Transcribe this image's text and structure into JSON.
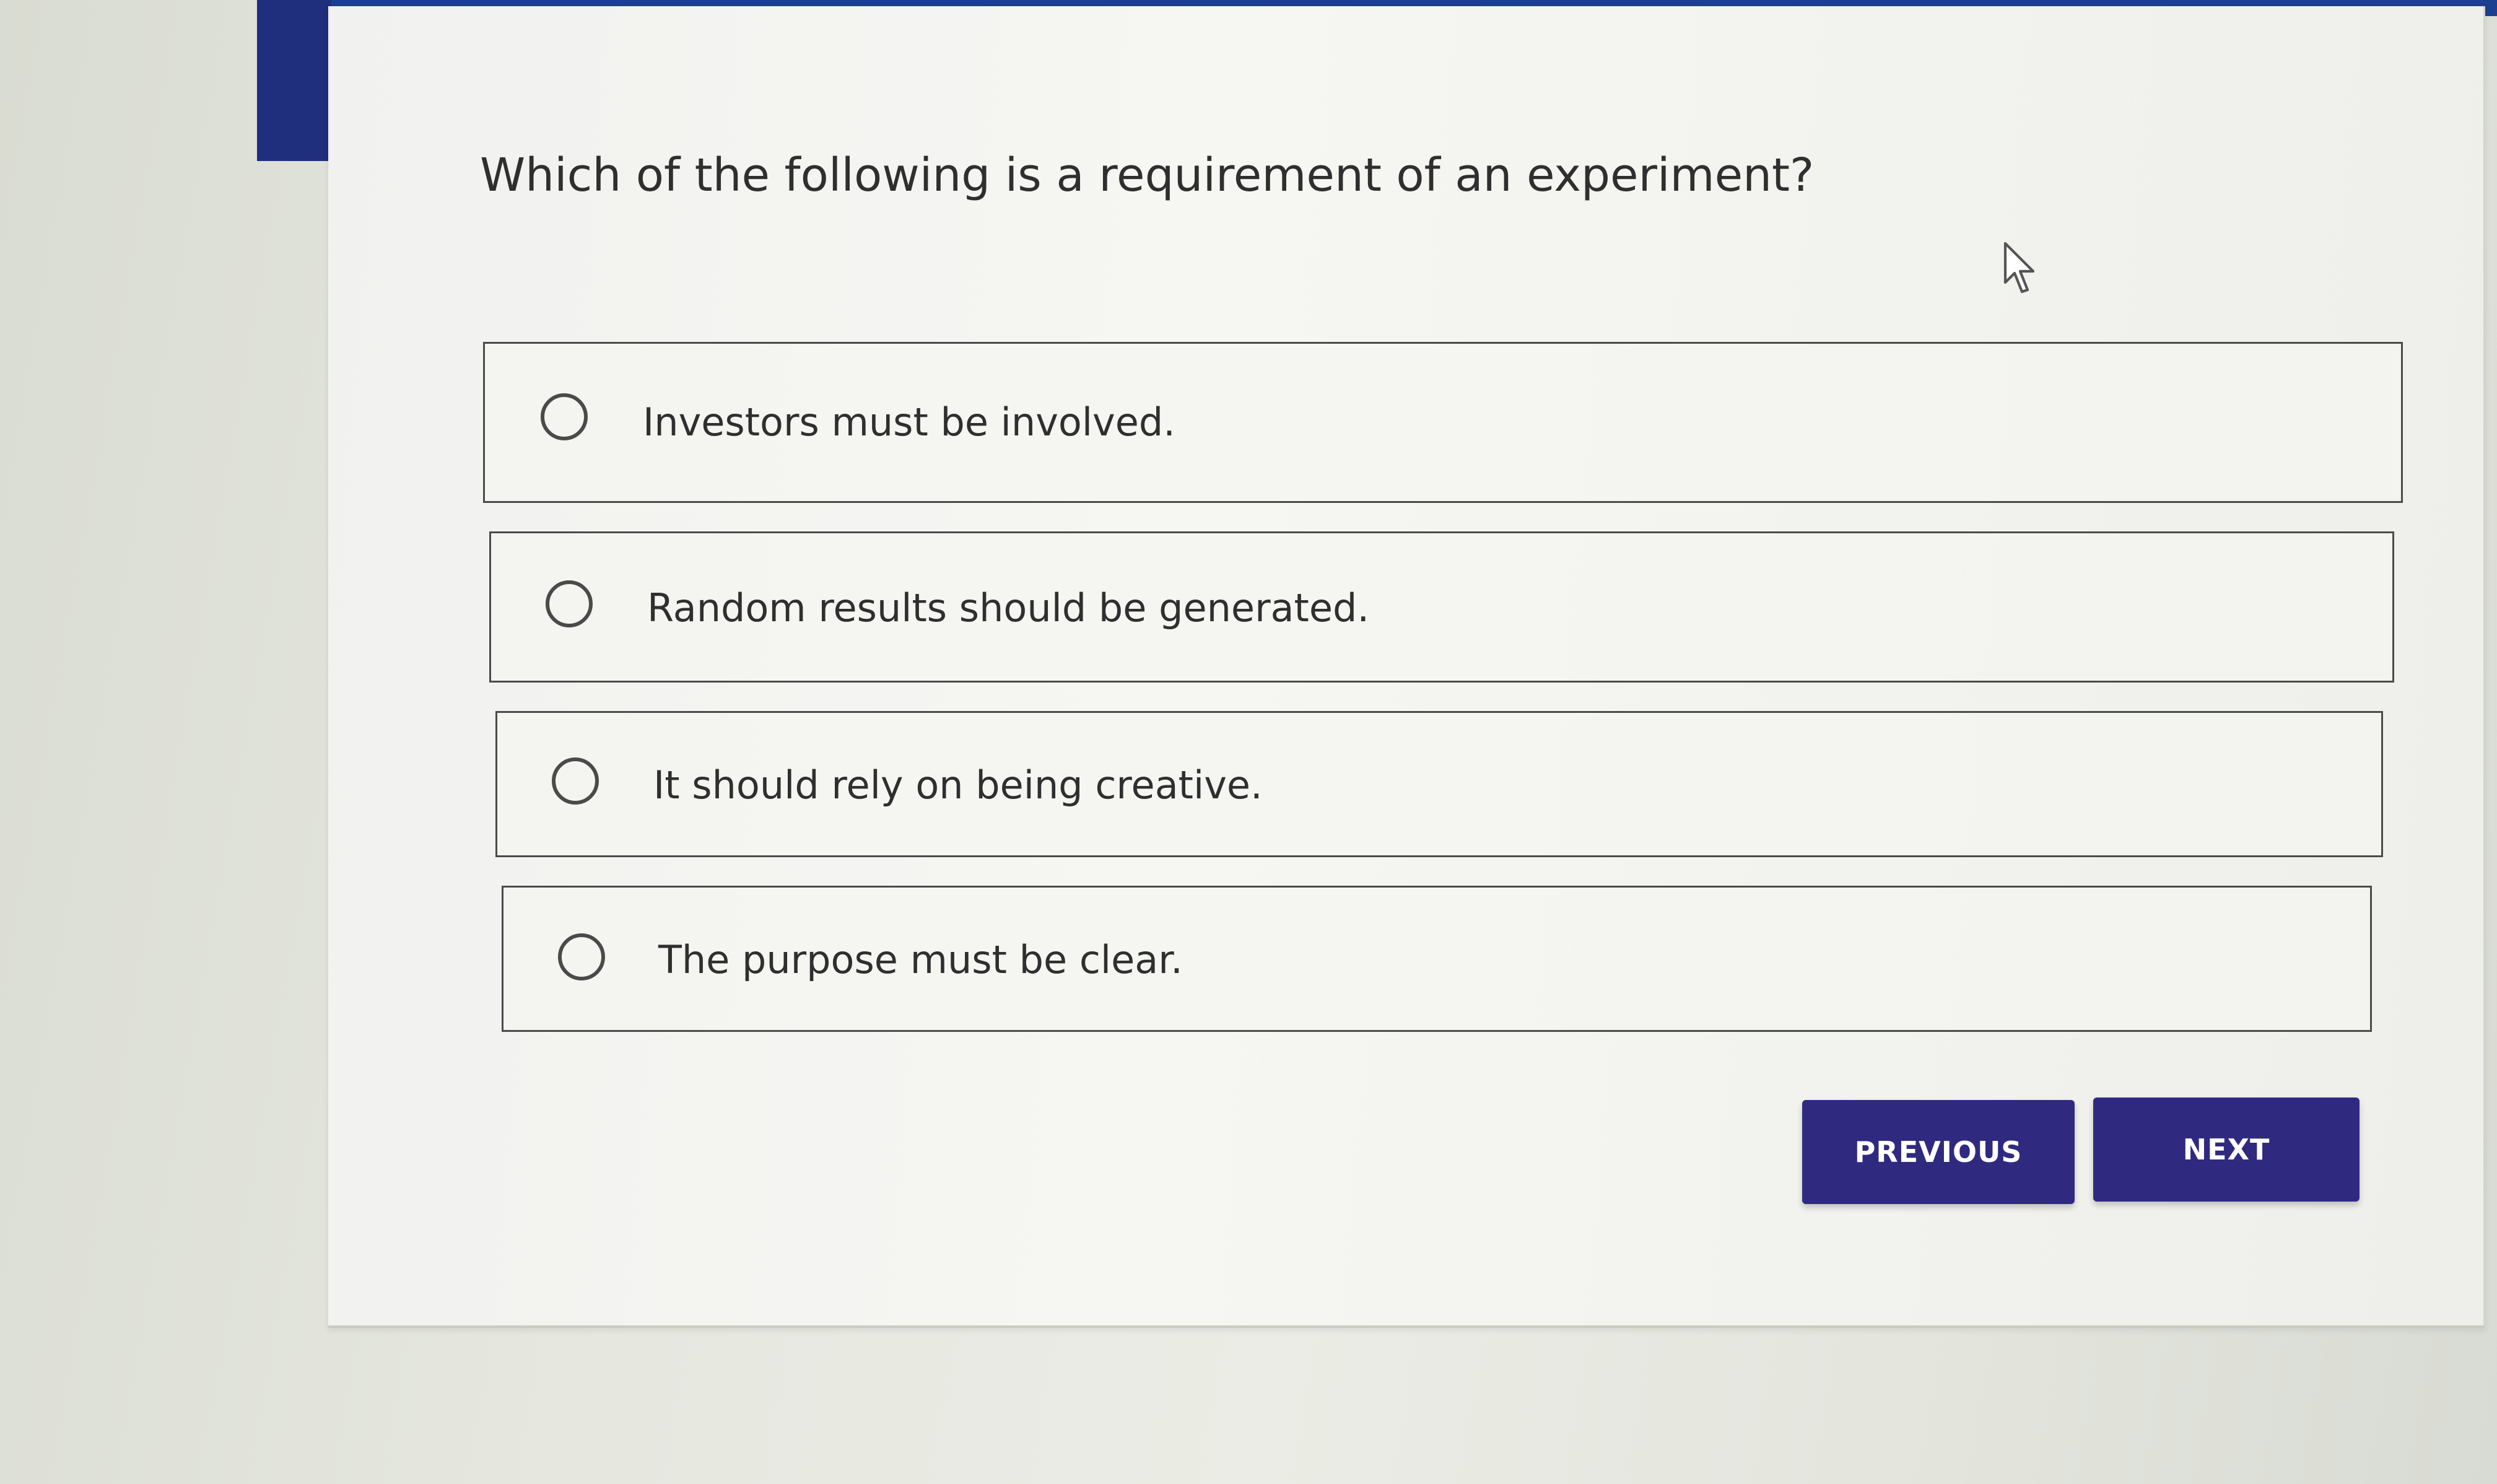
{
  "question": {
    "text": "Which of the following is a requirement of an experiment?"
  },
  "options": [
    {
      "label": "Investors must be involved.",
      "selected": false
    },
    {
      "label": "Random results should be generated.",
      "selected": false
    },
    {
      "label": "It should rely on being creative.",
      "selected": false
    },
    {
      "label": "The purpose must be clear.",
      "selected": false
    }
  ],
  "navigation": {
    "previous_label": "PREVIOUS",
    "next_label": "NEXT"
  },
  "colors": {
    "header_bar": "#1d3f8f",
    "button_bg": "#2f2a80",
    "button_text": "#ffffff"
  },
  "icons": {
    "cursor": "mouse-pointer-icon",
    "option_control": "radio-button-icon"
  }
}
